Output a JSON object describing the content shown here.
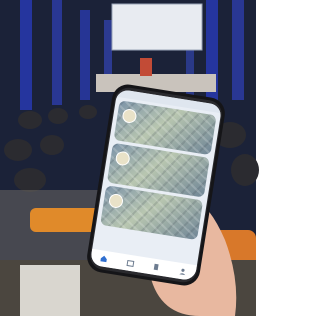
{
  "slides": {
    "line1": "",
    "line2": ""
  },
  "phone_app": {
    "cards": [
      {
        "title": "",
        "subtitle": ""
      },
      {
        "title": "",
        "subtitle": ""
      },
      {
        "title": "",
        "subtitle": ""
      }
    ],
    "tabs": [
      {
        "icon": "home-icon"
      },
      {
        "icon": "calendar-icon"
      },
      {
        "icon": "building-icon"
      },
      {
        "icon": "user-icon"
      }
    ]
  },
  "colors": {
    "stage_blue": "#2f3fb4",
    "nail_polish": "#7a1630",
    "seat_orange": "#e08a2a"
  }
}
